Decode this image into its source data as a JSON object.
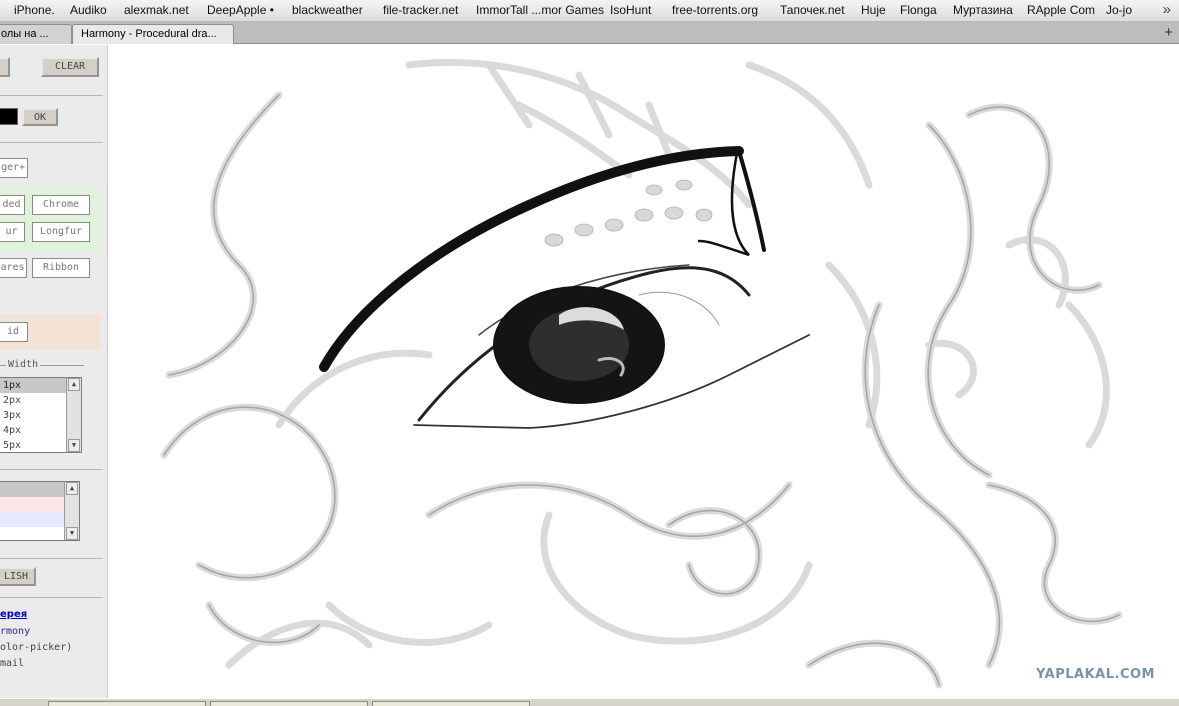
{
  "bookmarks": [
    "iPhone.",
    "Audiko",
    "alexmak.net",
    "DeepApple •",
    "blackweather",
    "file-tracker.net",
    "ImmorTall ...mor Games",
    "IsoHunt",
    "free-torrents.org",
    "Тапочек.net",
    "Huje",
    "Flonga",
    "Муртазина",
    "RApple Com",
    "Jo-jo"
  ],
  "bookmarks_more": "»",
  "tabs": [
    {
      "label": "олы на ..."
    },
    {
      "label": "Harmony - Procedural dra..."
    }
  ],
  "tab_add": "+",
  "panel": {
    "clear_label": "CLEAR",
    "ok_label": "OK",
    "brushes": {
      "top": "ger+",
      "row1": [
        "ded",
        "Chrome"
      ],
      "row2": [
        "ur",
        "Longfur"
      ],
      "row3": [
        "ares",
        "Ribbon"
      ],
      "grid": "id"
    },
    "width_legend": "Width",
    "width_options": [
      "1px",
      "2px",
      "3px",
      "4px",
      "5px"
    ],
    "publish_label": "LISH",
    "links": {
      "gallery": "ерея",
      "harmony": "rmony",
      "color_picker": "olor-picker)",
      "email": "mail"
    },
    "colors": {
      "swatch": "#000000",
      "brush_group_bg": "#e0f2dc",
      "grid_group_bg": "#f4e2d4",
      "link": "#0000cc"
    }
  },
  "canvas": {
    "watermark": "YAPLAKAL.COM"
  }
}
